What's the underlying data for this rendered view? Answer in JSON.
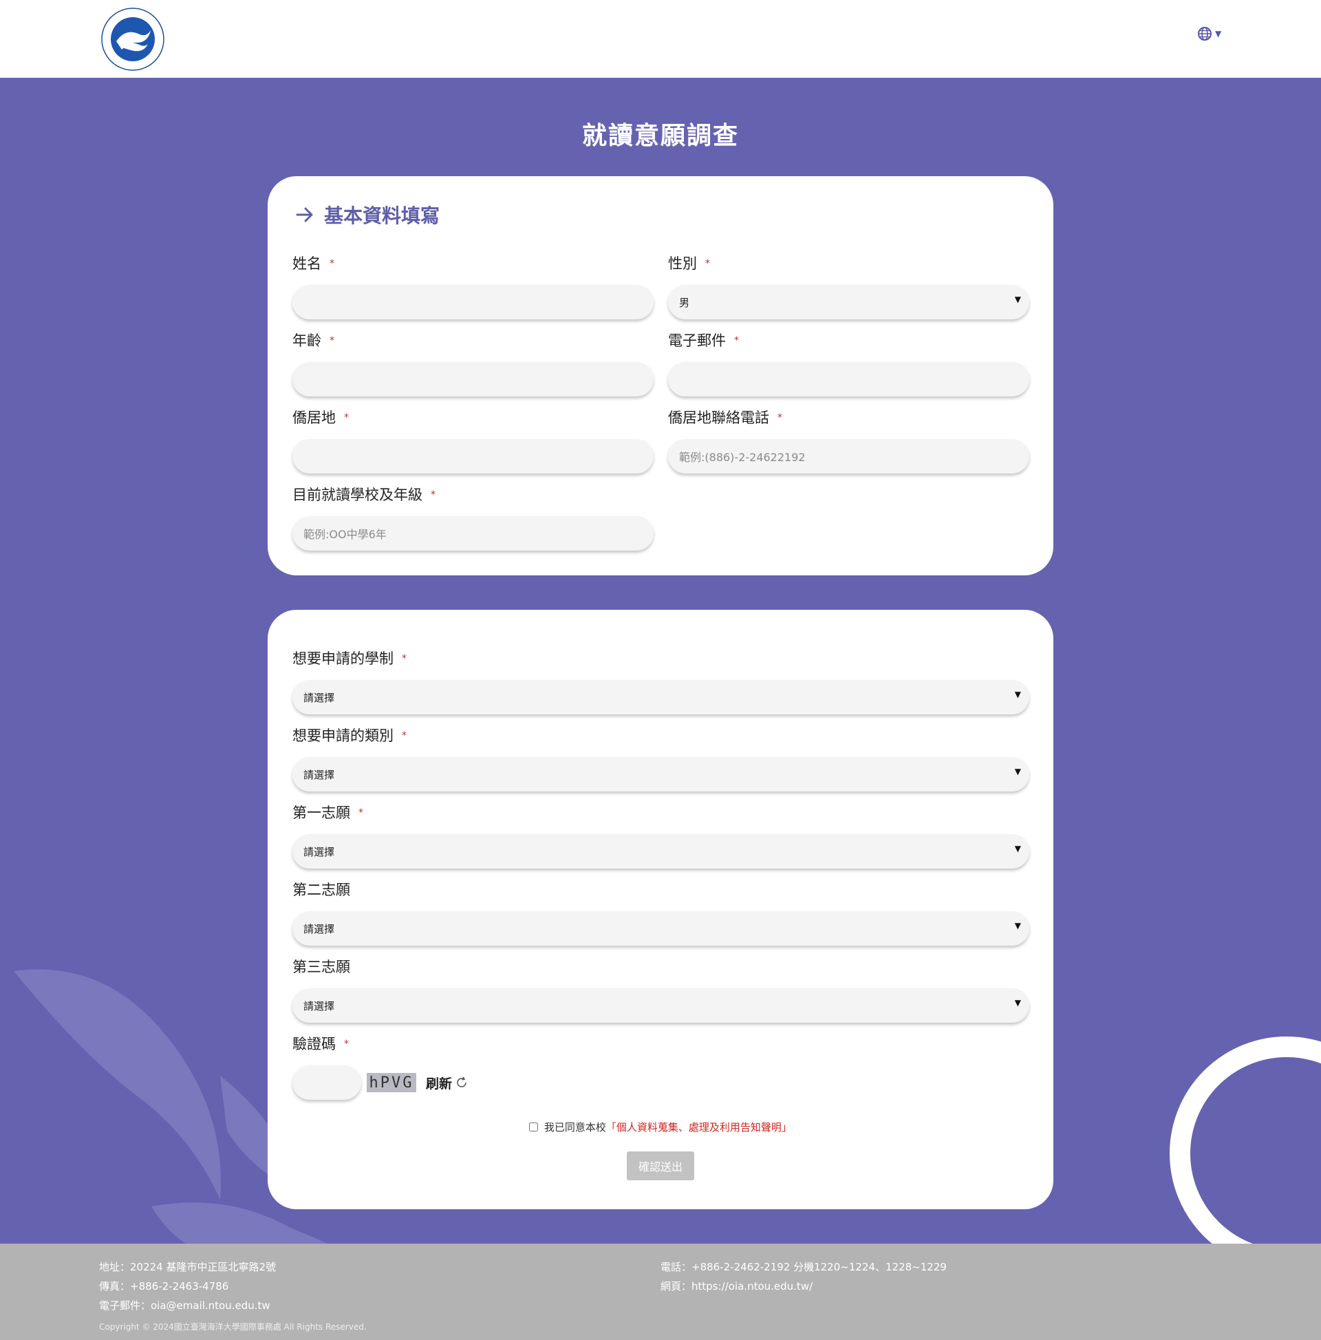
{
  "header": {
    "logo_name": "ntou-seal-logo",
    "lang_icon": "globe-icon"
  },
  "page_title": "就讀意願調查",
  "section1": {
    "heading": "基本資料填寫",
    "name_label": "姓名",
    "gender_label": "性別",
    "gender_value": "男",
    "age_label": "年齡",
    "email_label": "電子郵件",
    "residence_label": "僑居地",
    "phone_label": "僑居地聯絡電話",
    "phone_placeholder": "範例:(886)-2-24622192",
    "school_label": "目前就讀學校及年級",
    "school_placeholder": "範例:OO中學6年"
  },
  "section2": {
    "system_label": "想要申請的學制",
    "category_label": "想要申請的類別",
    "choice1_label": "第一志願",
    "choice2_label": "第二志願",
    "choice3_label": "第三志願",
    "select_placeholder": "請選擇",
    "captcha_label": "驗證碼",
    "captcha_text": "hPVG",
    "refresh_label": "刷新",
    "agree_text": "我已同意本校",
    "agree_link": "「個人資料蒐集、處理及利用告知聲明」",
    "submit_label": "確認送出"
  },
  "required_mark": "*",
  "footer": {
    "address": "地址：20224 基隆市中正區北寧路2號",
    "fax": "傳真：+886-2-2463-4786",
    "email": "電子郵件：oia@email.ntou.edu.tw",
    "phone": "電話：+886-2-2462-2192  分機1220~1224、1228~1229",
    "website": "網頁：https://oia.ntou.edu.tw/",
    "copyright": "Copyright © 2024國立臺灣海洋大學國際事務處 All Rights Reserved."
  },
  "colors": {
    "brand_purple": "#6563b0",
    "heading_purple": "#5f5ea8",
    "required_red": "#c52e2e",
    "footer_gray": "#b3b3b3"
  }
}
